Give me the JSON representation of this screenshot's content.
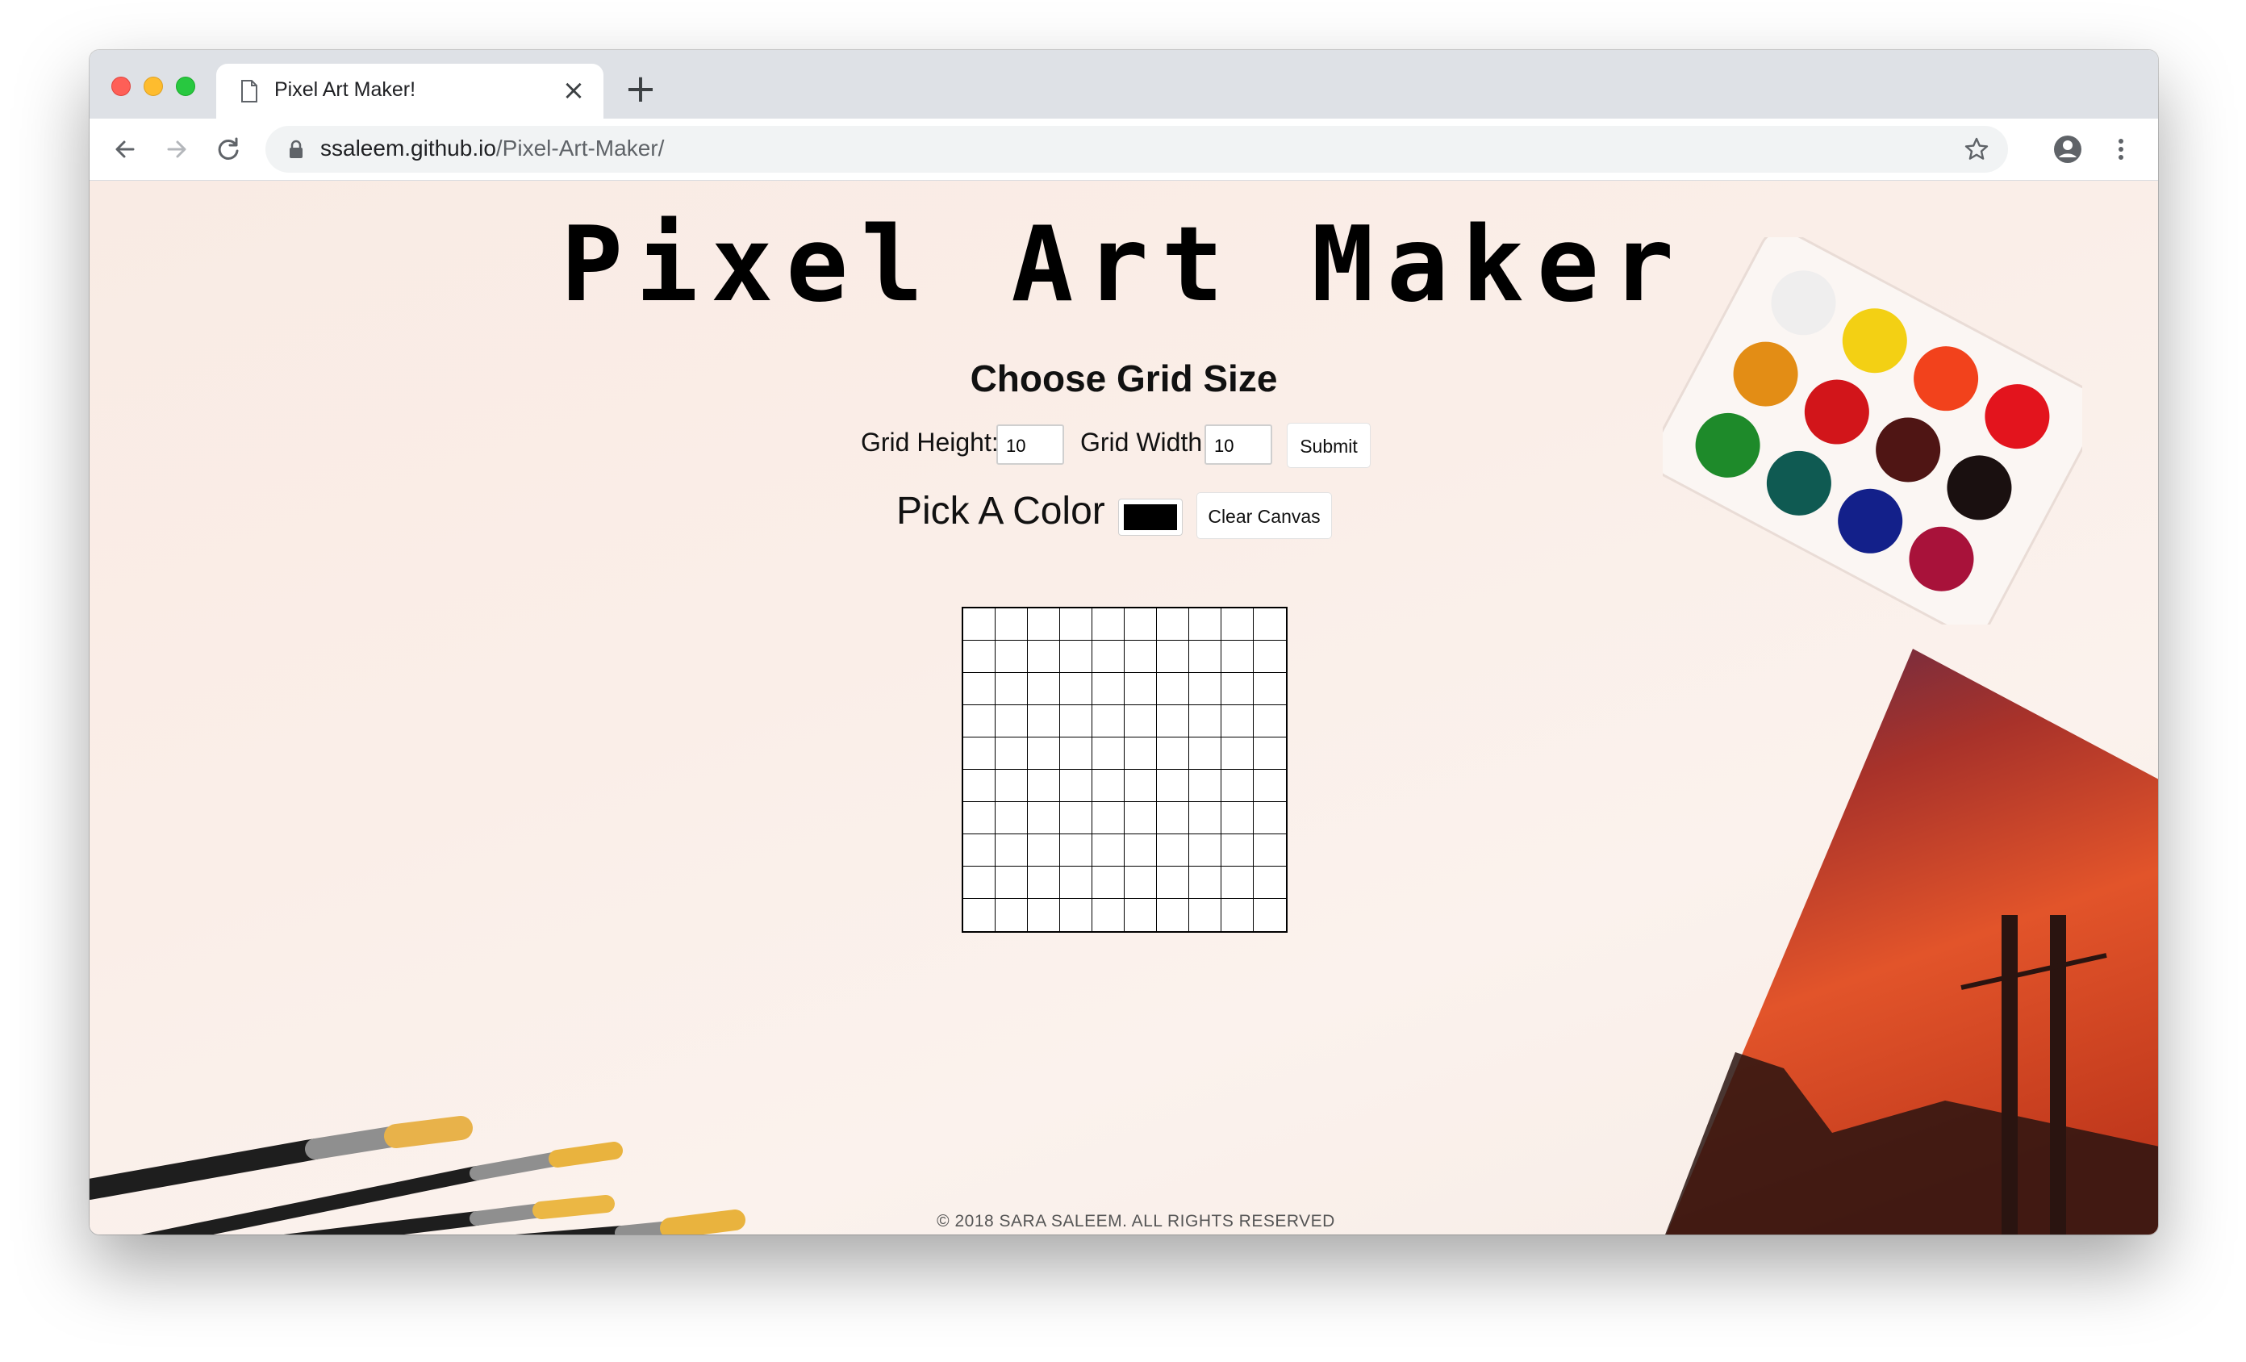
{
  "browser": {
    "tab_title": "Pixel Art Maker!",
    "url_host": "ssaleem.github.io",
    "url_path": "/Pixel-Art-Maker/"
  },
  "page": {
    "title": "Pixel Art Maker",
    "subtitle": "Choose Grid Size",
    "grid_height_label": "Grid Height:",
    "grid_height_value": "10",
    "grid_width_label": "Grid Width:",
    "grid_width_value": "10",
    "submit_label": "Submit",
    "pick_color_label": "Pick A Color",
    "selected_color": "#000000",
    "clear_canvas_label": "Clear Canvas",
    "grid_rows": 10,
    "grid_cols": 10,
    "footer": "© 2018 SARA SALEEM. ALL RIGHTS RESERVED"
  },
  "icons": {
    "favicon": "document-icon",
    "close": "close-icon",
    "new_tab": "plus-icon",
    "back": "arrow-left-icon",
    "forward": "arrow-right-icon",
    "reload": "reload-icon",
    "lock": "lock-icon",
    "bookmark": "star-icon",
    "profile": "account-icon",
    "menu": "kebab-menu-icon"
  },
  "colors": {
    "accent_titlebar": "#dee1e6",
    "page_background": "#f9ece6",
    "grid_line": "#000000"
  }
}
